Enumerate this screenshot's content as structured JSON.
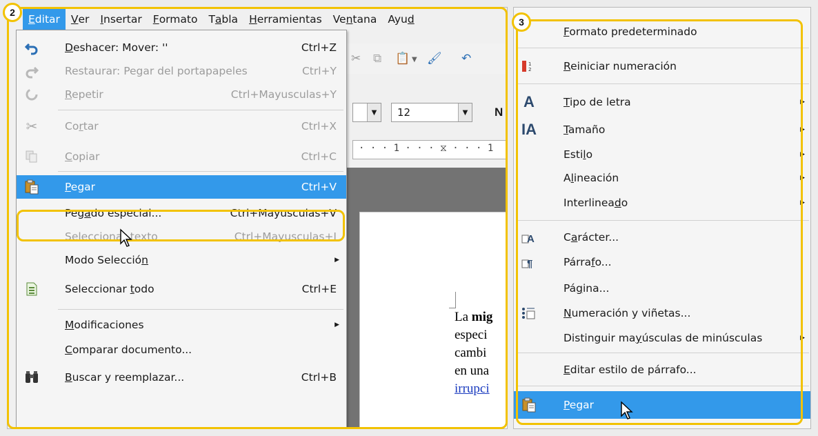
{
  "badges": {
    "left": "2",
    "right": "3"
  },
  "menubar": {
    "items": [
      {
        "label": "Editar",
        "key": "E",
        "rest": "ditar",
        "active": true
      },
      {
        "label": "Ver",
        "key": "V",
        "rest": "er"
      },
      {
        "label": "Insertar",
        "key": "I",
        "rest": "nsertar"
      },
      {
        "label": "Formato",
        "key": "F",
        "rest": "ormato"
      },
      {
        "label": "Tabla",
        "pre": "T",
        "key": "a",
        "rest": "bla"
      },
      {
        "label": "Herramientas",
        "key": "H",
        "rest": "erramientas"
      },
      {
        "label": "Ventana",
        "pre": "Ve",
        "key": "n",
        "rest": "tana"
      },
      {
        "label": "Ayuda",
        "pre": "Ayu",
        "key": "d",
        "rest": ""
      }
    ]
  },
  "editor_background": {
    "font_size_value": "12",
    "bold_label": "N",
    "ruler_text": "· · · 1 · · · ⧖ · · · 1",
    "doc_lines": [
      "La mig",
      "especi",
      "cambi",
      "en una",
      "irrupci"
    ]
  },
  "edit_menu": {
    "items": [
      {
        "pre": "",
        "key": "D",
        "rest": "eshacer: Mover: ''",
        "shortcut": "Ctrl+Z",
        "disabled": false
      },
      {
        "pre": "",
        "key": "",
        "rest": "Restaurar: Pegar del portapapeles",
        "shortcut": "Ctrl+Y",
        "disabled": true
      },
      {
        "pre": "",
        "key": "R",
        "rest": "epetir",
        "shortcut": "Ctrl+Mayusculas+Y",
        "disabled": true
      },
      {
        "pre": "Co",
        "key": "r",
        "rest": "tar",
        "shortcut": "Ctrl+X",
        "disabled": true
      },
      {
        "pre": "",
        "key": "C",
        "rest": "opiar",
        "shortcut": "Ctrl+C",
        "disabled": true
      },
      {
        "pre": "",
        "key": "P",
        "rest": "egar",
        "shortcut": "Ctrl+V",
        "highlighted": true
      },
      {
        "pre": "Peg",
        "key": "a",
        "rest": "do especial...",
        "shortcut": "Ctrl+Mayusculas+V"
      },
      {
        "pre": "",
        "key": "S",
        "rest": "eleccionar texto",
        "shortcut": "Ctrl+Mayusculas+I",
        "disabled": true
      },
      {
        "pre": "Modo Selecció",
        "key": "n",
        "rest": "",
        "submenu": true
      },
      {
        "pre": "Seleccionar ",
        "key": "t",
        "rest": "odo",
        "shortcut": "Ctrl+E"
      },
      {
        "pre": "",
        "key": "M",
        "rest": "odificaciones",
        "submenu": true
      },
      {
        "pre": "",
        "key": "C",
        "rest": "omparar documento..."
      },
      {
        "pre": "",
        "key": "B",
        "rest": "uscar y reemplazar...",
        "shortcut": "Ctrl+B"
      }
    ]
  },
  "format_menu": {
    "items": [
      {
        "pre": "",
        "key": "F",
        "rest": "ormato predeterminado"
      },
      {
        "pre": "",
        "key": "R",
        "rest": "einiciar numeración"
      },
      {
        "pre": "",
        "key": "T",
        "rest": "ipo de letra",
        "submenu": true
      },
      {
        "pre": "",
        "key": "T",
        "rest": "amaño",
        "submenu": true
      },
      {
        "pre": "Esti",
        "key": "l",
        "rest": "o",
        "submenu": true
      },
      {
        "pre": "A",
        "key": "l",
        "rest": "ineación",
        "submenu": true
      },
      {
        "pre": "Interlinea",
        "key": "d",
        "rest": "o",
        "submenu": true
      },
      {
        "pre": "C",
        "key": "a",
        "rest": "rácter..."
      },
      {
        "pre": "Párra",
        "key": "f",
        "rest": "o..."
      },
      {
        "pre": "Pá",
        "key": "g",
        "rest": "ina..."
      },
      {
        "pre": "",
        "key": "N",
        "rest": "umeración y viñetas..."
      },
      {
        "pre": "Distinguir ma",
        "key": "y",
        "rest": "úsculas de minúsculas",
        "submenu": true
      },
      {
        "pre": "",
        "key": "E",
        "rest": "ditar estilo de párrafo..."
      },
      {
        "pre": "",
        "key": "P",
        "rest": "egar",
        "highlighted": true
      }
    ]
  },
  "colors": {
    "highlight": "#3399ea",
    "callout": "#f2c200"
  }
}
